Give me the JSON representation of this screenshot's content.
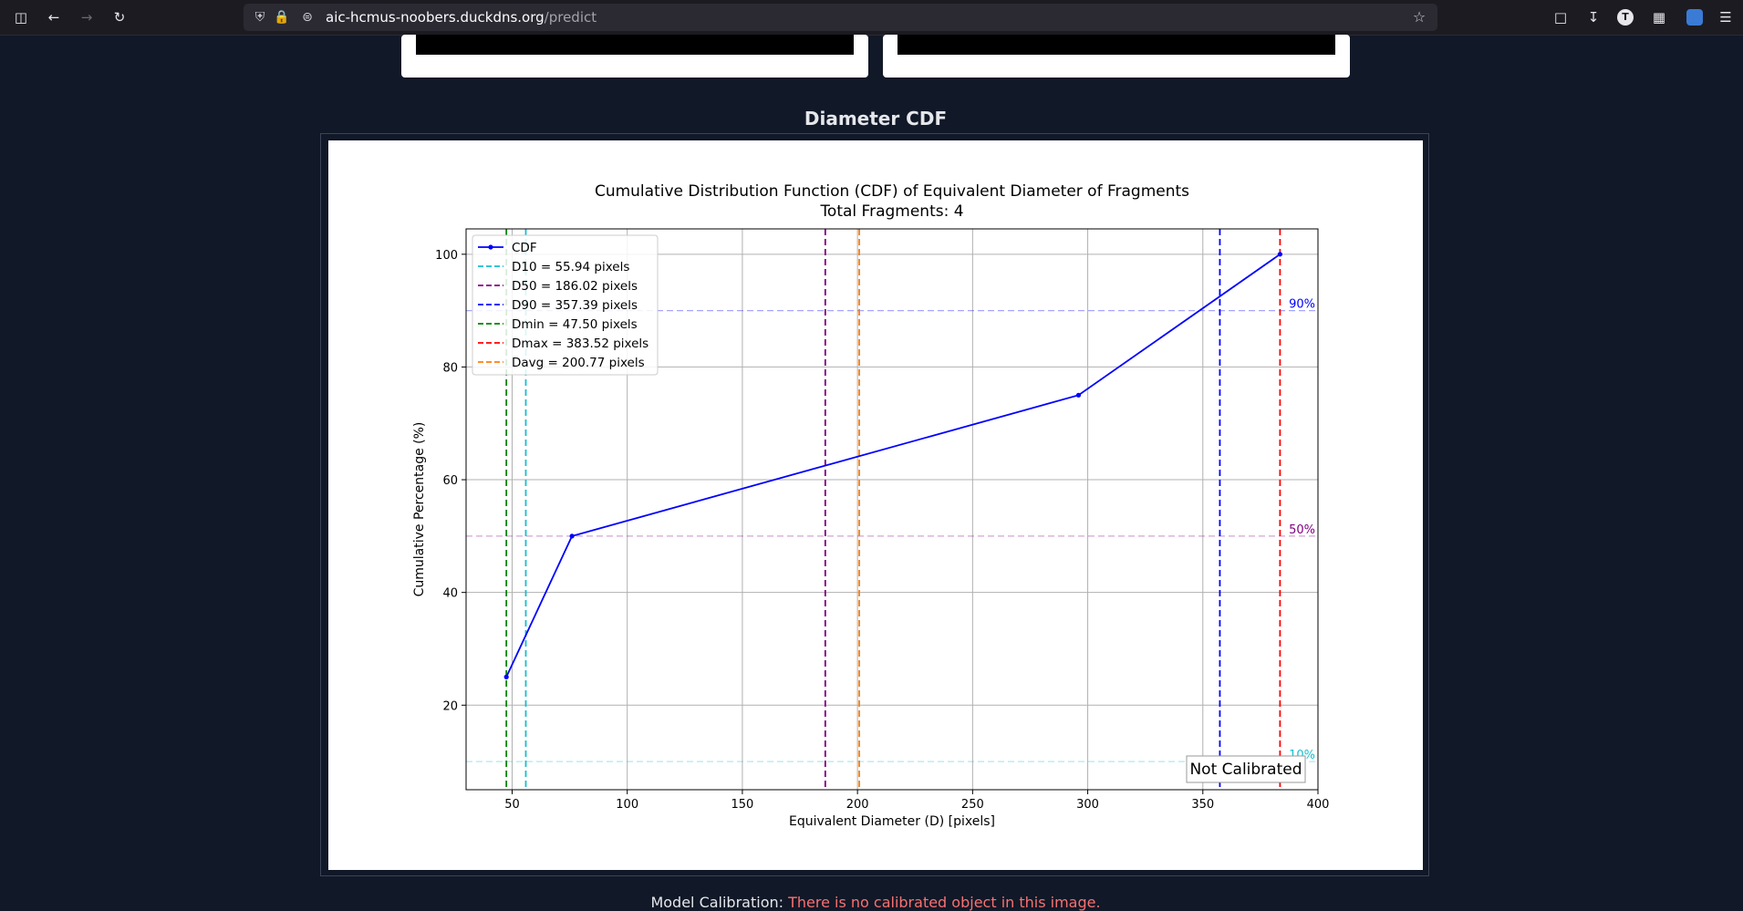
{
  "browser": {
    "url_host": "aic-hcmus-noobers.duckdns.org",
    "url_path": "/predict",
    "profile_initial": "T"
  },
  "section": {
    "title": "Diameter CDF"
  },
  "calibration": {
    "label": "Model Calibration:",
    "status": "There is no calibrated object in this image."
  },
  "chart_data": {
    "type": "line",
    "title": "Cumulative Distribution Function (CDF) of Equivalent Diameter of Fragments",
    "subtitle": "Total Fragments: 4",
    "xlabel": "Equivalent Diameter (D) [pixels]",
    "ylabel": "Cumulative Percentage (%)",
    "xlim": [
      30,
      400
    ],
    "ylim": [
      5,
      104.5
    ],
    "xticks": [
      50,
      100,
      150,
      200,
      250,
      300,
      350,
      400
    ],
    "yticks": [
      20,
      40,
      60,
      80,
      100
    ],
    "grid": true,
    "legend_position": "upper left",
    "series": [
      {
        "name": "CDF",
        "color": "#0000ff",
        "x": [
          47.5,
          76,
          296,
          383.52
        ],
        "y": [
          25,
          50,
          75,
          100
        ]
      }
    ],
    "vlines": [
      {
        "label": "D10 = 55.94 pixels",
        "x": 55.94,
        "color": "#17becf"
      },
      {
        "label": "D50 = 186.02 pixels",
        "x": 186.02,
        "color": "#800080"
      },
      {
        "label": "D90 = 357.39 pixels",
        "x": 357.39,
        "color": "#0000ff"
      },
      {
        "label": "Dmin = 47.50 pixels",
        "x": 47.5,
        "color": "#008000"
      },
      {
        "label": "Dmax = 383.52 pixels",
        "x": 383.52,
        "color": "#ff0000"
      },
      {
        "label": "Davg = 200.77 pixels",
        "x": 200.77,
        "color": "#ff7f0e"
      }
    ],
    "hlines": [
      {
        "label": "90%",
        "y": 90,
        "color": "#0000ff"
      },
      {
        "label": "50%",
        "y": 50,
        "color": "#800080"
      },
      {
        "label": "10%",
        "y": 10,
        "color": "#17becf"
      }
    ],
    "annotation": "Not Calibrated"
  }
}
